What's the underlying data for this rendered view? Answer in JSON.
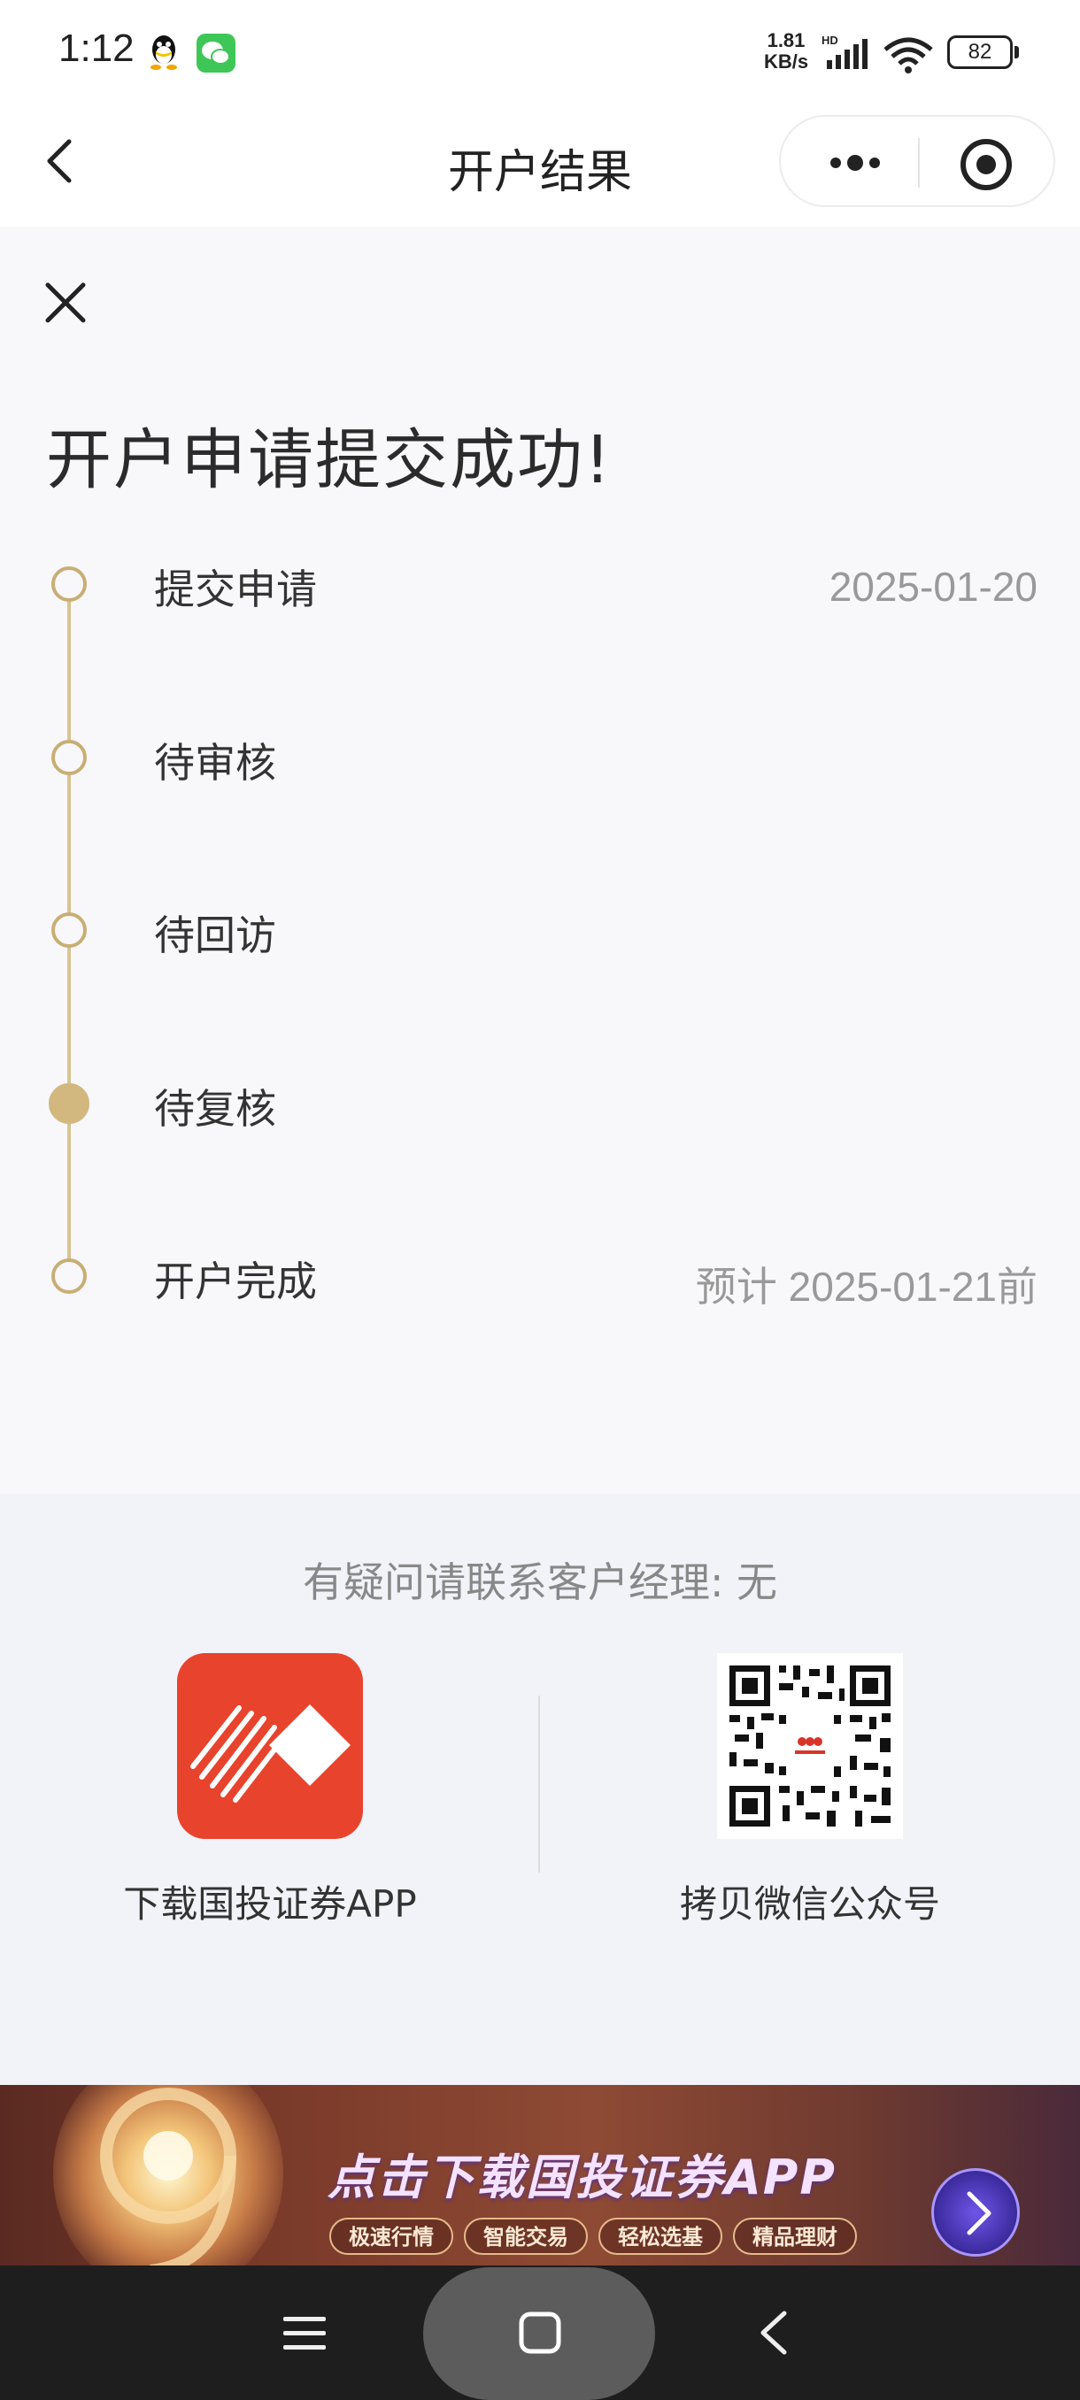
{
  "status_bar": {
    "time": "1:12",
    "net_speed_value": "1.81",
    "net_speed_unit": "KB/s",
    "network_type": "HD",
    "battery": "82"
  },
  "nav": {
    "title": "开户结果"
  },
  "result": {
    "title": "开户申请提交成功!",
    "steps": [
      {
        "label": "提交申请",
        "date": "2025-01-20",
        "active": false
      },
      {
        "label": "待审核",
        "date": "",
        "active": false
      },
      {
        "label": "待回访",
        "date": "",
        "active": false
      },
      {
        "label": "待复核",
        "date": "",
        "active": true
      },
      {
        "label": "开户完成",
        "date": "预计 2025-01-21前",
        "active": false
      }
    ]
  },
  "contact": {
    "text": "有疑问请联系客户经理:  无"
  },
  "download": {
    "app_label": "下载国投证券APP",
    "qr_label": "拷贝微信公众号"
  },
  "banner": {
    "title": "点击下载国投证券APP",
    "tags": [
      "极速行情",
      "智能交易",
      "轻松选基",
      "精品理财"
    ]
  },
  "colors": {
    "timeline_gold": "#c9ae74",
    "logo_red": "#e8432c",
    "page_bg": "#f2f3f8"
  }
}
